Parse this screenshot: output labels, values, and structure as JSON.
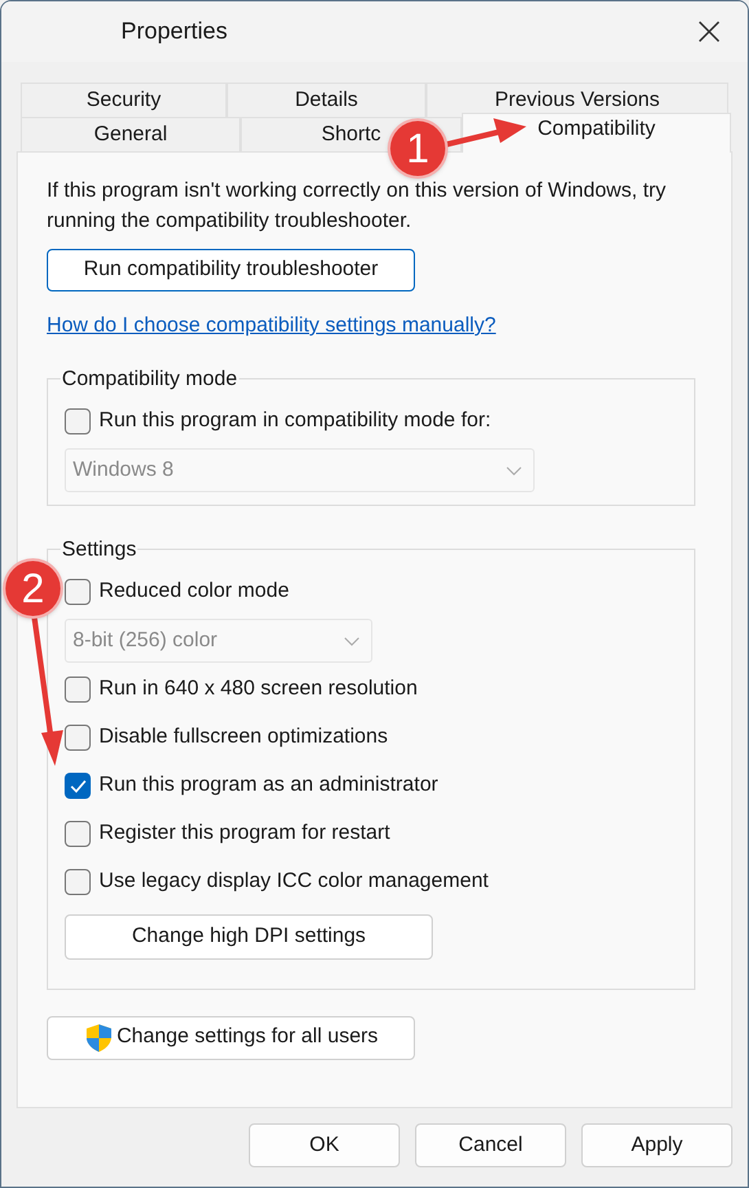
{
  "window": {
    "title": "Properties"
  },
  "tabs_row_1": [
    {
      "label": "Security",
      "selected": false
    },
    {
      "label": "Details",
      "selected": false
    },
    {
      "label": "Previous Versions",
      "selected": false
    }
  ],
  "tabs_row_2": [
    {
      "label": "General",
      "selected": false
    },
    {
      "label": "Shortc",
      "selected": false
    },
    {
      "label": "Compatibility",
      "selected": true
    }
  ],
  "intro": "If this program isn't working correctly on this version of Windows, try running the compatibility troubleshooter.",
  "troubleshooter_button": "Run compatibility troubleshooter",
  "help_link": "How do I choose compatibility settings manually?",
  "compatibility_mode": {
    "title": "Compatibility mode",
    "checkbox": {
      "label": "Run this program in compatibility mode for:",
      "checked": false
    },
    "dropdown": {
      "value": "Windows 8",
      "disabled": true
    }
  },
  "settings": {
    "title": "Settings",
    "items": [
      {
        "kind": "checkbox",
        "label": "Reduced color mode",
        "checked": false
      },
      {
        "kind": "dropdown",
        "value": "8-bit (256) color",
        "disabled": true
      },
      {
        "kind": "checkbox",
        "label": "Run in 640 x 480 screen resolution",
        "checked": false
      },
      {
        "kind": "checkbox",
        "label": "Disable fullscreen optimizations",
        "checked": false
      },
      {
        "kind": "checkbox",
        "label": "Run this program as an administrator",
        "checked": true
      },
      {
        "kind": "checkbox",
        "label": "Register this program for restart",
        "checked": false
      },
      {
        "kind": "checkbox",
        "label": "Use legacy display ICC color management",
        "checked": false
      },
      {
        "kind": "button",
        "label": "Change high DPI settings"
      }
    ]
  },
  "all_users_button": "Change settings for all users",
  "buttons": [
    "OK",
    "Cancel",
    "Apply"
  ],
  "annotations": [
    {
      "label": "1"
    },
    {
      "label": "2"
    }
  ]
}
